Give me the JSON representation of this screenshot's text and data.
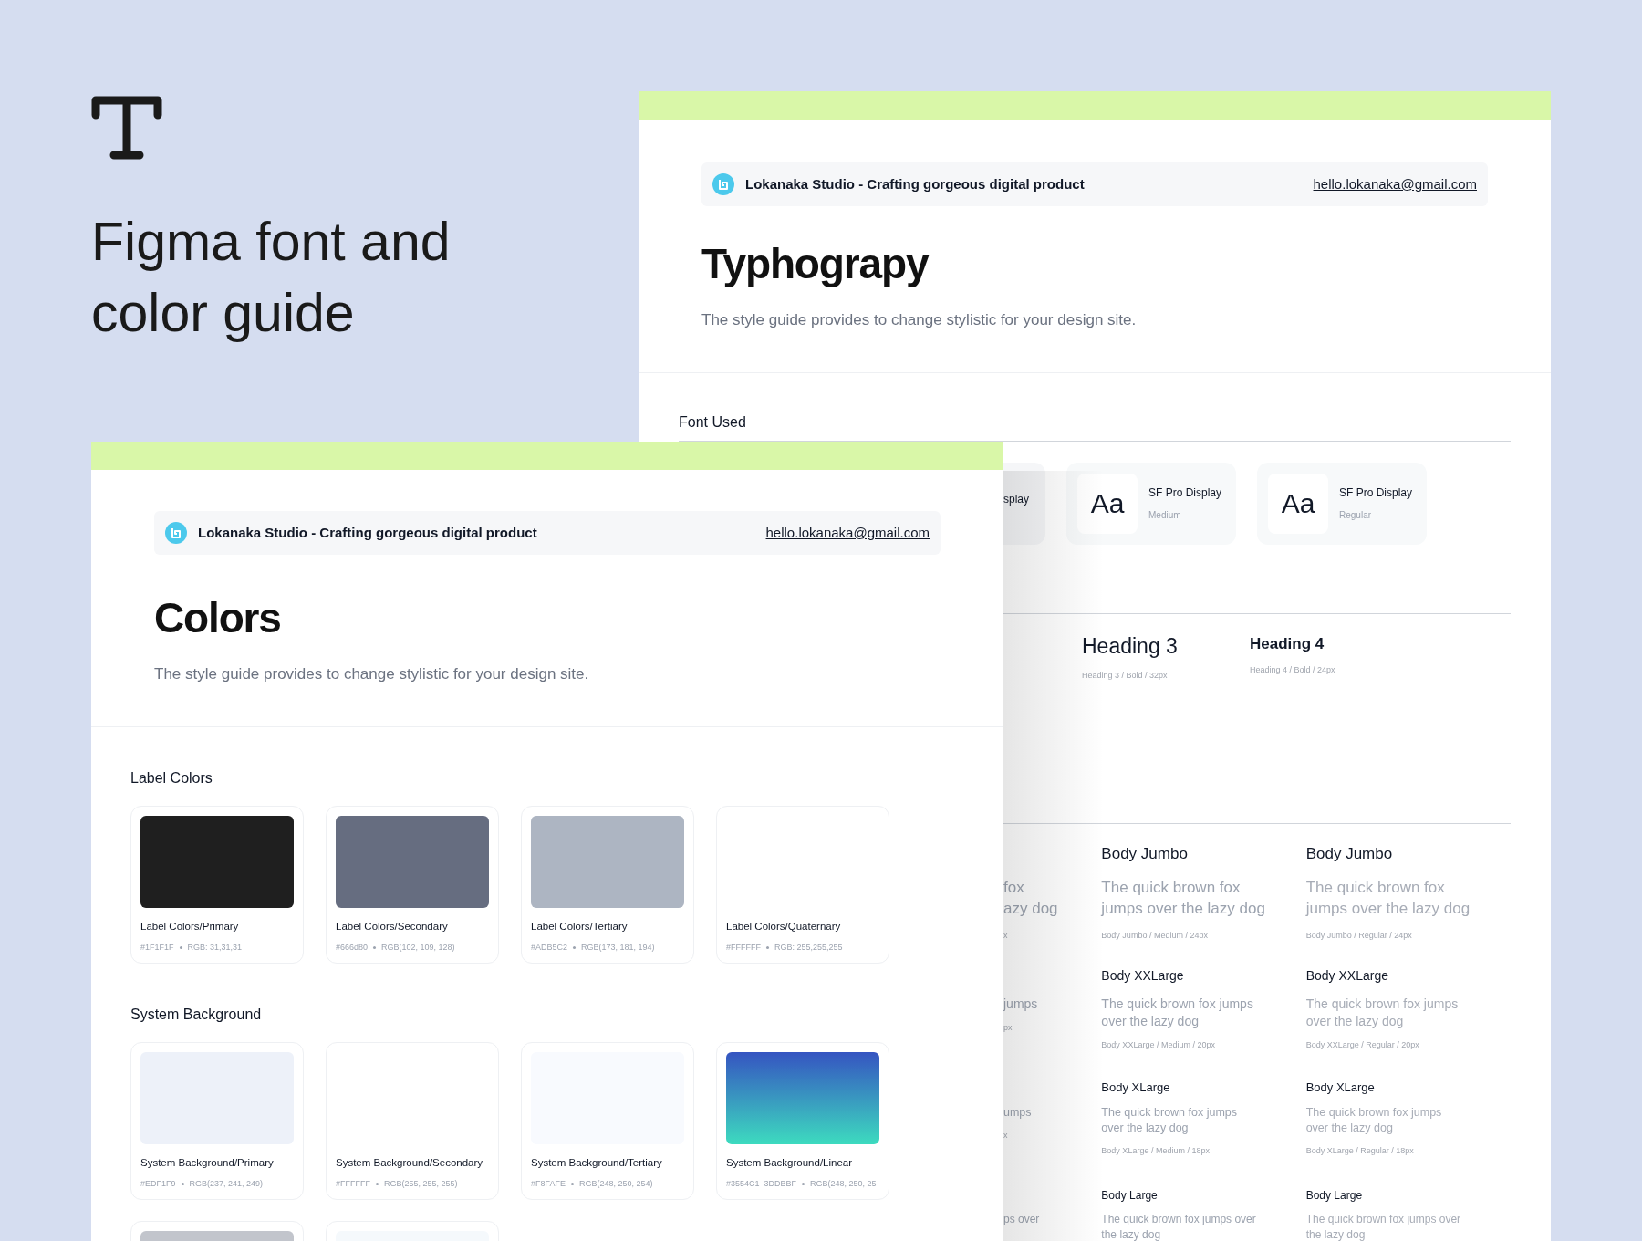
{
  "hero": {
    "title_lines": [
      "Figma font and",
      "color guide"
    ]
  },
  "typography_page": {
    "header": {
      "brand": "Lokanaka Studio - Crafting gorgeous digital product",
      "email": "hello.lokanaka@gmail.com"
    },
    "title": "Typhograpy",
    "subtitle": "The style guide provides to change stylistic for your design site.",
    "font_section": {
      "title": "Font Used",
      "cards": [
        {
          "kind": "fragment",
          "name": "splay"
        },
        {
          "kind": "full",
          "sample": "Aa",
          "name": "SF Pro Display",
          "weight": "Medium"
        },
        {
          "kind": "full",
          "sample": "Aa",
          "name": "SF Pro Display",
          "weight": "Regular"
        }
      ]
    },
    "headings": [
      {
        "kind": "h3",
        "name": "Heading 3",
        "caption": "Heading 3 / Bold / 32px"
      },
      {
        "kind": "h4",
        "name": "Heading 4",
        "caption": "Heading 4 / Bold / 24px"
      }
    ],
    "body_rows": [
      {
        "kind": "jumbo",
        "fragment": {
          "sample_lines": [
            "fox",
            "azy dog"
          ],
          "caption": "x"
        },
        "styles": [
          {
            "kind": "medium",
            "title": "Body Jumbo",
            "sample_lines": [
              "The quick brown fox",
              "jumps over the lazy dog"
            ],
            "caption": "Body Jumbo / Medium / 24px"
          },
          {
            "kind": "regular",
            "title": "Body Jumbo",
            "sample_lines": [
              "The quick brown fox",
              "jumps over the lazy dog"
            ],
            "caption": "Body Jumbo / Regular / 24px"
          }
        ]
      },
      {
        "kind": "xxlarge",
        "fragment": {
          "sample_lines": [
            "jumps"
          ],
          "caption": "px"
        },
        "styles": [
          {
            "kind": "medium",
            "title": "Body XXLarge",
            "sample_lines": [
              "The quick brown fox jumps",
              "over the lazy dog"
            ],
            "caption": "Body XXLarge / Medium / 20px"
          },
          {
            "kind": "regular",
            "title": "Body XXLarge",
            "sample_lines": [
              "The quick brown fox jumps",
              "over the lazy dog"
            ],
            "caption": "Body XXLarge / Regular / 20px"
          }
        ]
      },
      {
        "kind": "xlarge",
        "fragment": {
          "sample_lines": [
            "umps"
          ],
          "caption": "x"
        },
        "styles": [
          {
            "kind": "medium",
            "title": "Body XLarge",
            "sample_lines": [
              "The quick brown fox jumps",
              "over the lazy dog"
            ],
            "caption": "Body XLarge / Medium / 18px"
          },
          {
            "kind": "regular",
            "title": "Body XLarge",
            "sample_lines": [
              "The quick brown fox jumps",
              "over the lazy dog"
            ],
            "caption": "Body XLarge / Regular / 18px"
          }
        ]
      },
      {
        "kind": "large",
        "fragment": {
          "sample_lines": [
            "ps over"
          ]
        },
        "styles": [
          {
            "kind": "medium",
            "title": "Body Large",
            "sample_lines": [
              "The quick brown fox jumps over",
              "the lazy dog"
            ]
          },
          {
            "kind": "regular",
            "title": "Body Large",
            "sample_lines": [
              "The quick brown fox jumps over",
              "the lazy dog"
            ]
          }
        ]
      }
    ]
  },
  "colors_page": {
    "header": {
      "brand": "Lokanaka Studio - Crafting gorgeous digital product",
      "email": "hello.lokanaka@gmail.com"
    },
    "title": "Colors",
    "subtitle": "The style guide provides to change stylistic for your design site.",
    "sections": [
      {
        "title": "Label Colors",
        "cards": [
          {
            "name": "Label Colors/Primary",
            "hex": "#1F1F1F",
            "rgb": "RGB: 31,31,31",
            "swatch": {
              "kind": "solid",
              "color": "#1f1f1f"
            }
          },
          {
            "name": "Label Colors/Secondary",
            "hex": "#666d80",
            "rgb": "RGB(102, 109, 128)",
            "swatch": {
              "kind": "solid",
              "color": "#666d80"
            }
          },
          {
            "name": "Label Colors/Tertiary",
            "hex": "#ADB5C2",
            "rgb": "RGB(173, 181, 194)",
            "swatch": {
              "kind": "solid",
              "color": "#adb5c2"
            }
          },
          {
            "name": "Label Colors/Quaternary",
            "hex": "#FFFFFF",
            "rgb": "RGB: 255,255,255",
            "swatch": {
              "kind": "blank"
            }
          }
        ]
      },
      {
        "title": "System Background",
        "cards": [
          {
            "name": "System Background/Primary",
            "hex": "#EDF1F9",
            "rgb": "RGB(237, 241, 249)",
            "swatch": {
              "kind": "solid",
              "color": "#edf1f9"
            }
          },
          {
            "name": "System Background/Secondary",
            "hex": "#FFFFFF",
            "rgb": "RGB(255, 255, 255)",
            "swatch": {
              "kind": "blank"
            }
          },
          {
            "name": "System Background/Tertiary",
            "hex": "#F8FAFE",
            "rgb": "RGB(248, 250, 254)",
            "swatch": {
              "kind": "solid",
              "color": "#f8fafe"
            }
          },
          {
            "name": "System Background/Linear",
            "hex": "#3554C1  3DDBBF",
            "rgb": "RGB(248, 250, 25",
            "swatch": {
              "kind": "gradient",
              "stops": [
                {
                  "color": "#3554c1"
                },
                {
                  "color": "#3ddbbf"
                }
              ]
            }
          }
        ],
        "more_swatches": [
          {
            "kind": "solid",
            "color": "#c2c5cc"
          },
          {
            "kind": "solid",
            "color": "#f5f9fc"
          }
        ]
      }
    ]
  }
}
